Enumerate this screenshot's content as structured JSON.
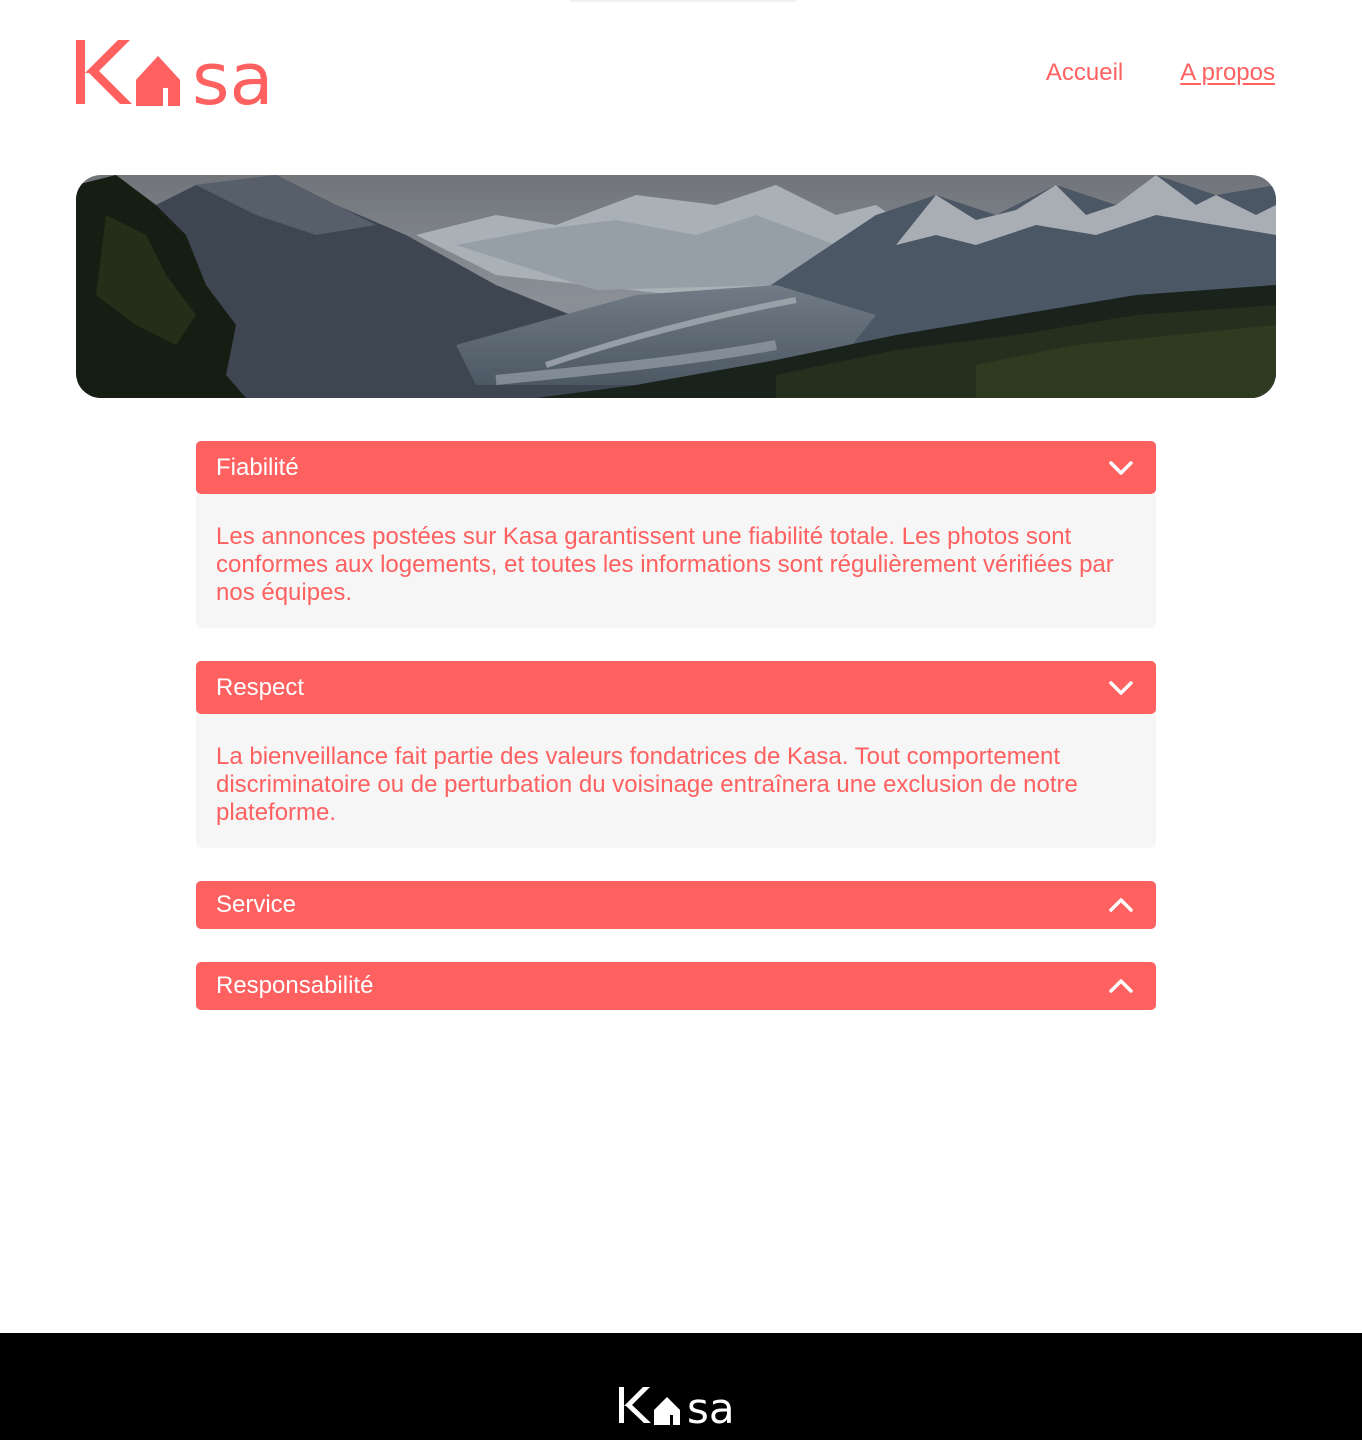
{
  "brand": {
    "name": "Kasa",
    "accent": "#FF6060",
    "footer_bg": "#000000",
    "panel_bg": "#F6F6F6"
  },
  "nav": {
    "items": [
      {
        "label": "Accueil",
        "active": false
      },
      {
        "label": "A propos",
        "active": true
      }
    ]
  },
  "banner": {
    "image": "mountain-valley-landscape"
  },
  "collapses": [
    {
      "title": "Fiabilité",
      "open": true,
      "icon": "chevron-down-icon",
      "content": "Les annonces postées sur Kasa garantissent une fiabilité totale. Les photos sont conformes aux logements, et toutes les informations sont régulièrement vérifiées par nos équipes."
    },
    {
      "title": "Respect",
      "open": true,
      "icon": "chevron-down-icon",
      "content": "La bienveillance fait partie des valeurs fondatrices de Kasa. Tout comportement discriminatoire ou de perturbation du voisinage entraînera une exclusion de notre plateforme."
    },
    {
      "title": "Service",
      "open": false,
      "icon": "chevron-up-icon"
    },
    {
      "title": "Responsabilité",
      "open": false,
      "icon": "chevron-up-icon"
    }
  ],
  "footer": {
    "logo": "Kasa"
  }
}
